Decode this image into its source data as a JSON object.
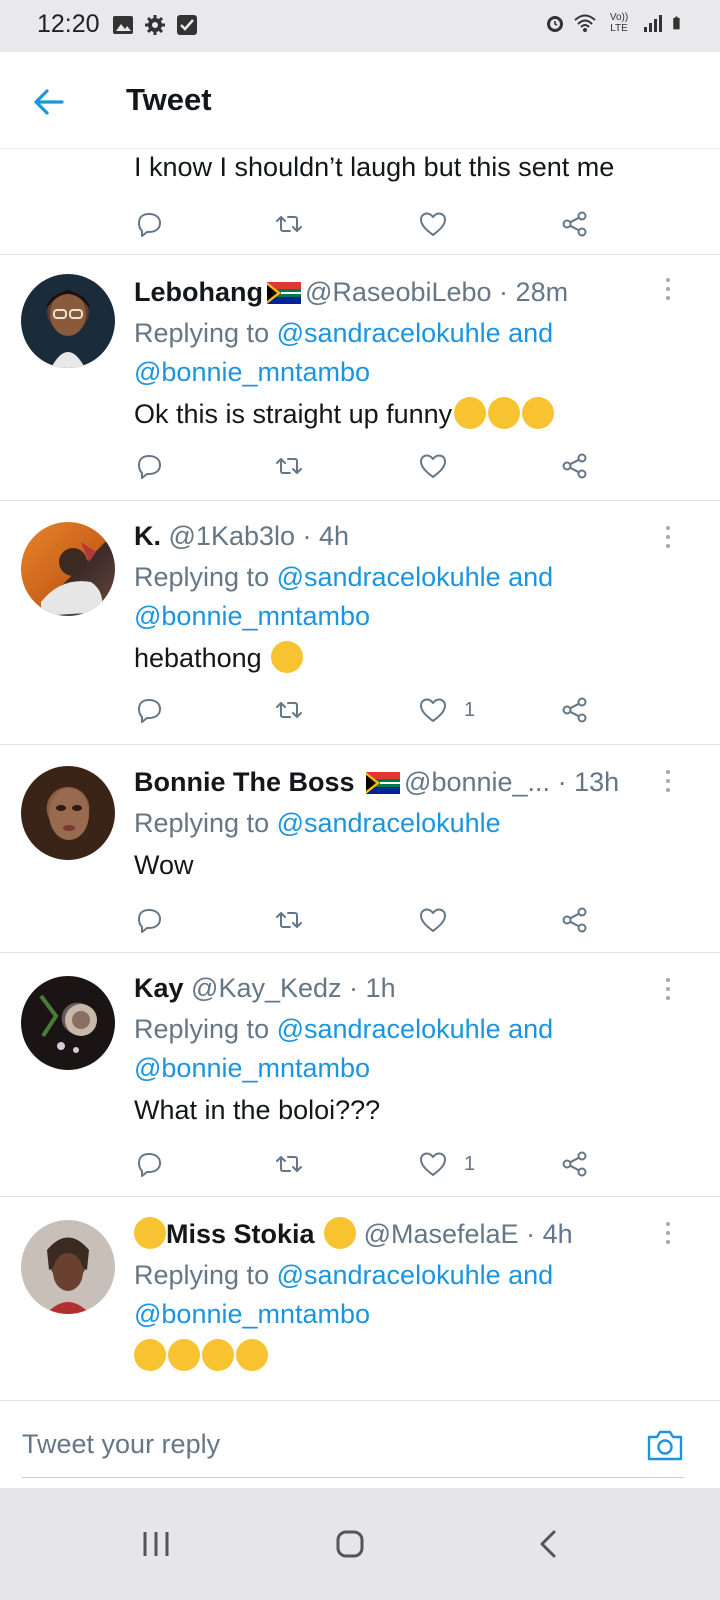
{
  "status_bar": {
    "time": "12:20",
    "lte_label": "Vo)) LTE"
  },
  "header": {
    "title": "Tweet"
  },
  "top_tweet": {
    "text": "I know I shouldn’t laugh but this sent me"
  },
  "tweets": [
    {
      "name": "Lebohang",
      "handle": "@RaseobiLebo",
      "time": "28m",
      "replying_prefix": "Replying to ",
      "mentions_line1": "@sandracelokuhle and",
      "mentions_line2": "@bonnie_mntambo",
      "text": "Ok this is straight up funny",
      "like_count": ""
    },
    {
      "name": "K.",
      "handle": "@1Kab3lo",
      "time": "4h",
      "replying_prefix": "Replying to ",
      "mentions_line1": "@sandracelokuhle and",
      "mentions_line2": "@bonnie_mntambo",
      "text": "hebathong",
      "like_count": "1"
    },
    {
      "name": "Bonnie The Boss",
      "handle": "@bonnie_...",
      "time": "13h",
      "replying_prefix": "Replying to ",
      "mentions_line1": "@sandracelokuhle",
      "text": "Wow",
      "like_count": ""
    },
    {
      "name": "Kay",
      "handle": "@Kay_Kedz",
      "time": "1h",
      "replying_prefix": "Replying to ",
      "mentions_line1": "@sandracelokuhle and",
      "mentions_line2": "@bonnie_mntambo",
      "text": "What in the boloi???",
      "like_count": "1"
    },
    {
      "name": "Miss Stokia",
      "handle": "@MasefelaE",
      "time": "4h",
      "replying_prefix": "Replying to ",
      "mentions_line1": "@sandracelokuhle and",
      "mentions_line2": "@bonnie_mntambo",
      "text": ""
    }
  ],
  "composer": {
    "placeholder": "Tweet your reply"
  },
  "colors": {
    "accent": "#1b95e0",
    "muted": "#657786",
    "text": "#14171a",
    "divider": "#dfe4e8"
  },
  "icons": [
    "back-arrow-icon",
    "reply-icon",
    "retweet-icon",
    "like-icon",
    "share-icon",
    "more-icon",
    "camera-icon",
    "recent-apps-icon",
    "home-icon",
    "nav-back-icon"
  ]
}
